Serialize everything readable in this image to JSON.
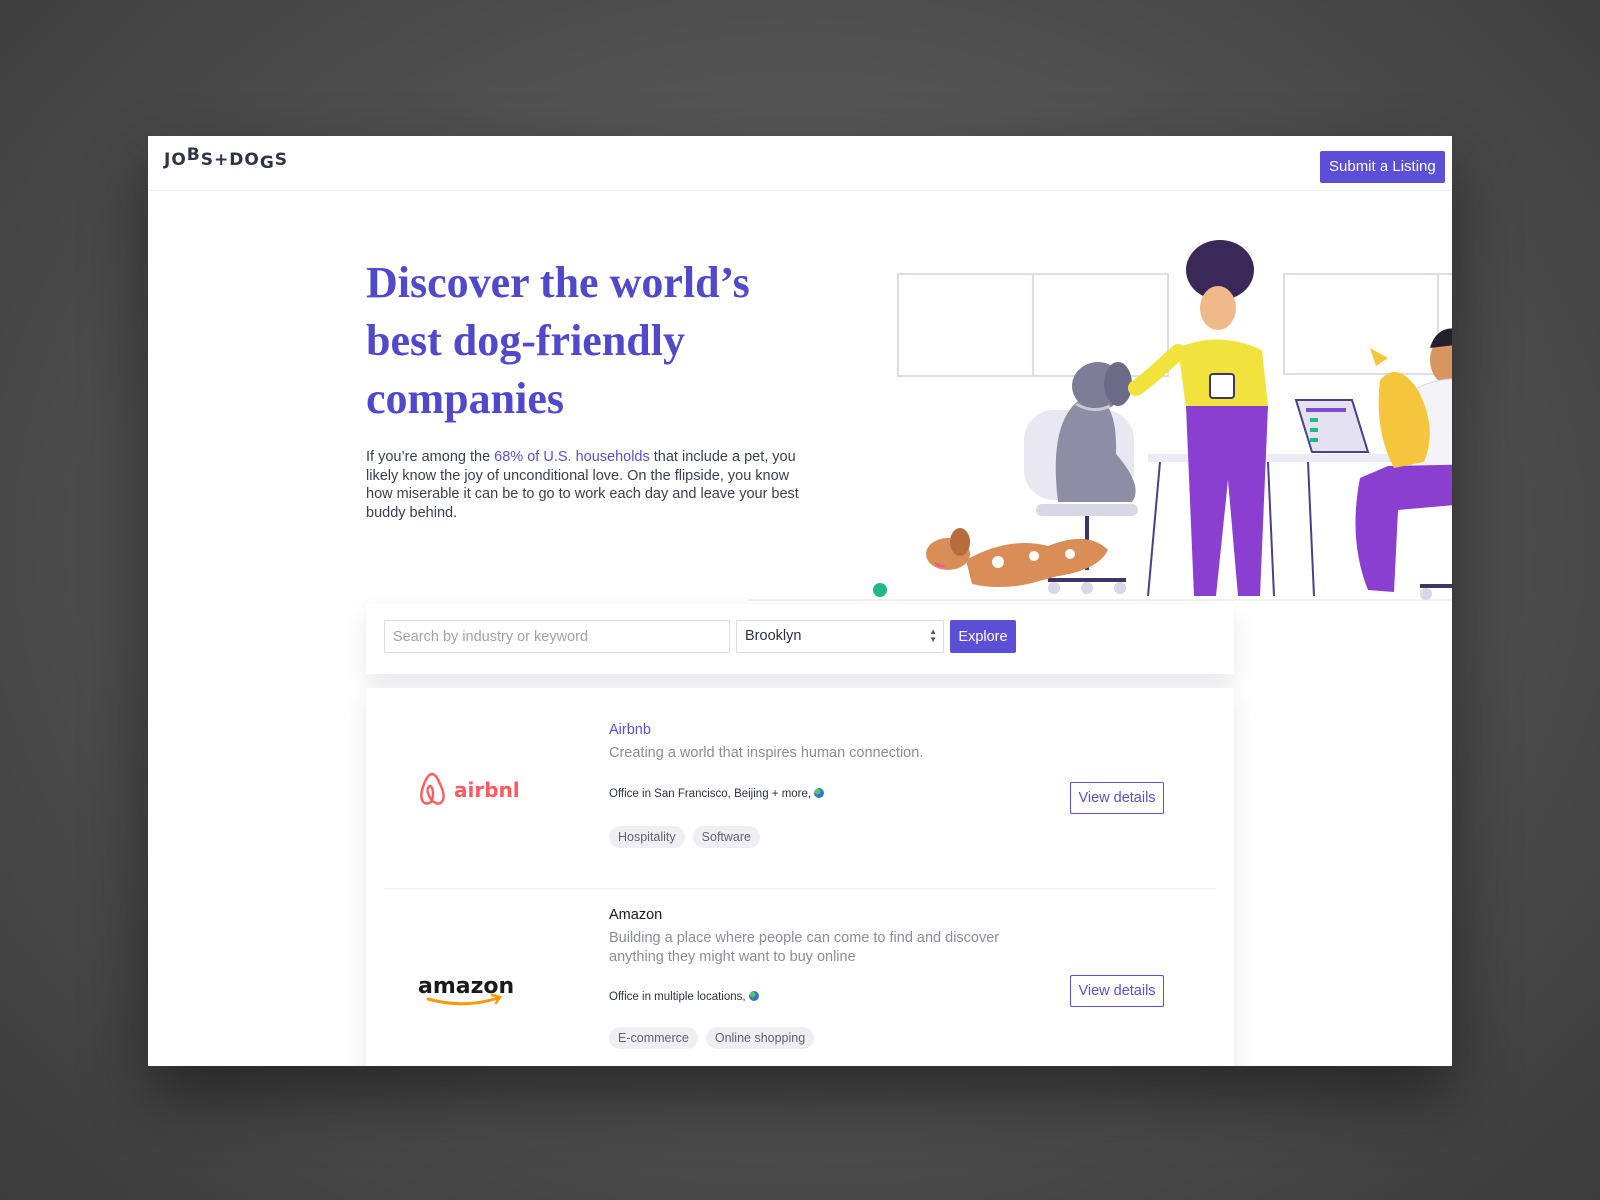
{
  "brand": {
    "logo_parts": [
      "JO",
      "B",
      "S",
      "+",
      "DO",
      "G",
      "S"
    ],
    "submit_label": "Submit a Listing",
    "accent_color": "#5a4fd6"
  },
  "hero": {
    "title": "Discover the world’s best dog-friendly companies",
    "text_before": "If you’re among the ",
    "link_text": "68% of U.S. households",
    "text_after": " that include a pet, you likely know the joy of unconditional love. On the flipside, you know how miserable it can be to go to work each day and leave your best buddy behind."
  },
  "search": {
    "placeholder": "Search by industry or keyword",
    "value": "",
    "location": "Brooklyn",
    "explore_label": "Explore"
  },
  "listings": [
    {
      "name": "Airbnb",
      "logo_text": "airbnb",
      "logo_color": "#ff5a5f",
      "tagline": "Creating a world that inspires human connection.",
      "office": "Office in San Francisco, Beijing + more,",
      "tags": [
        "Hospitality",
        "Software"
      ],
      "view_label": "View details"
    },
    {
      "name": "Amazon",
      "logo_text": "amazon",
      "logo_color": "#1a1a1a",
      "tagline": "Building a place where people can come to find and discover anything they might want to buy online",
      "office": "Office in multiple locations,",
      "tags": [
        "E-commerce",
        "Online shopping"
      ],
      "view_label": "View details"
    }
  ]
}
